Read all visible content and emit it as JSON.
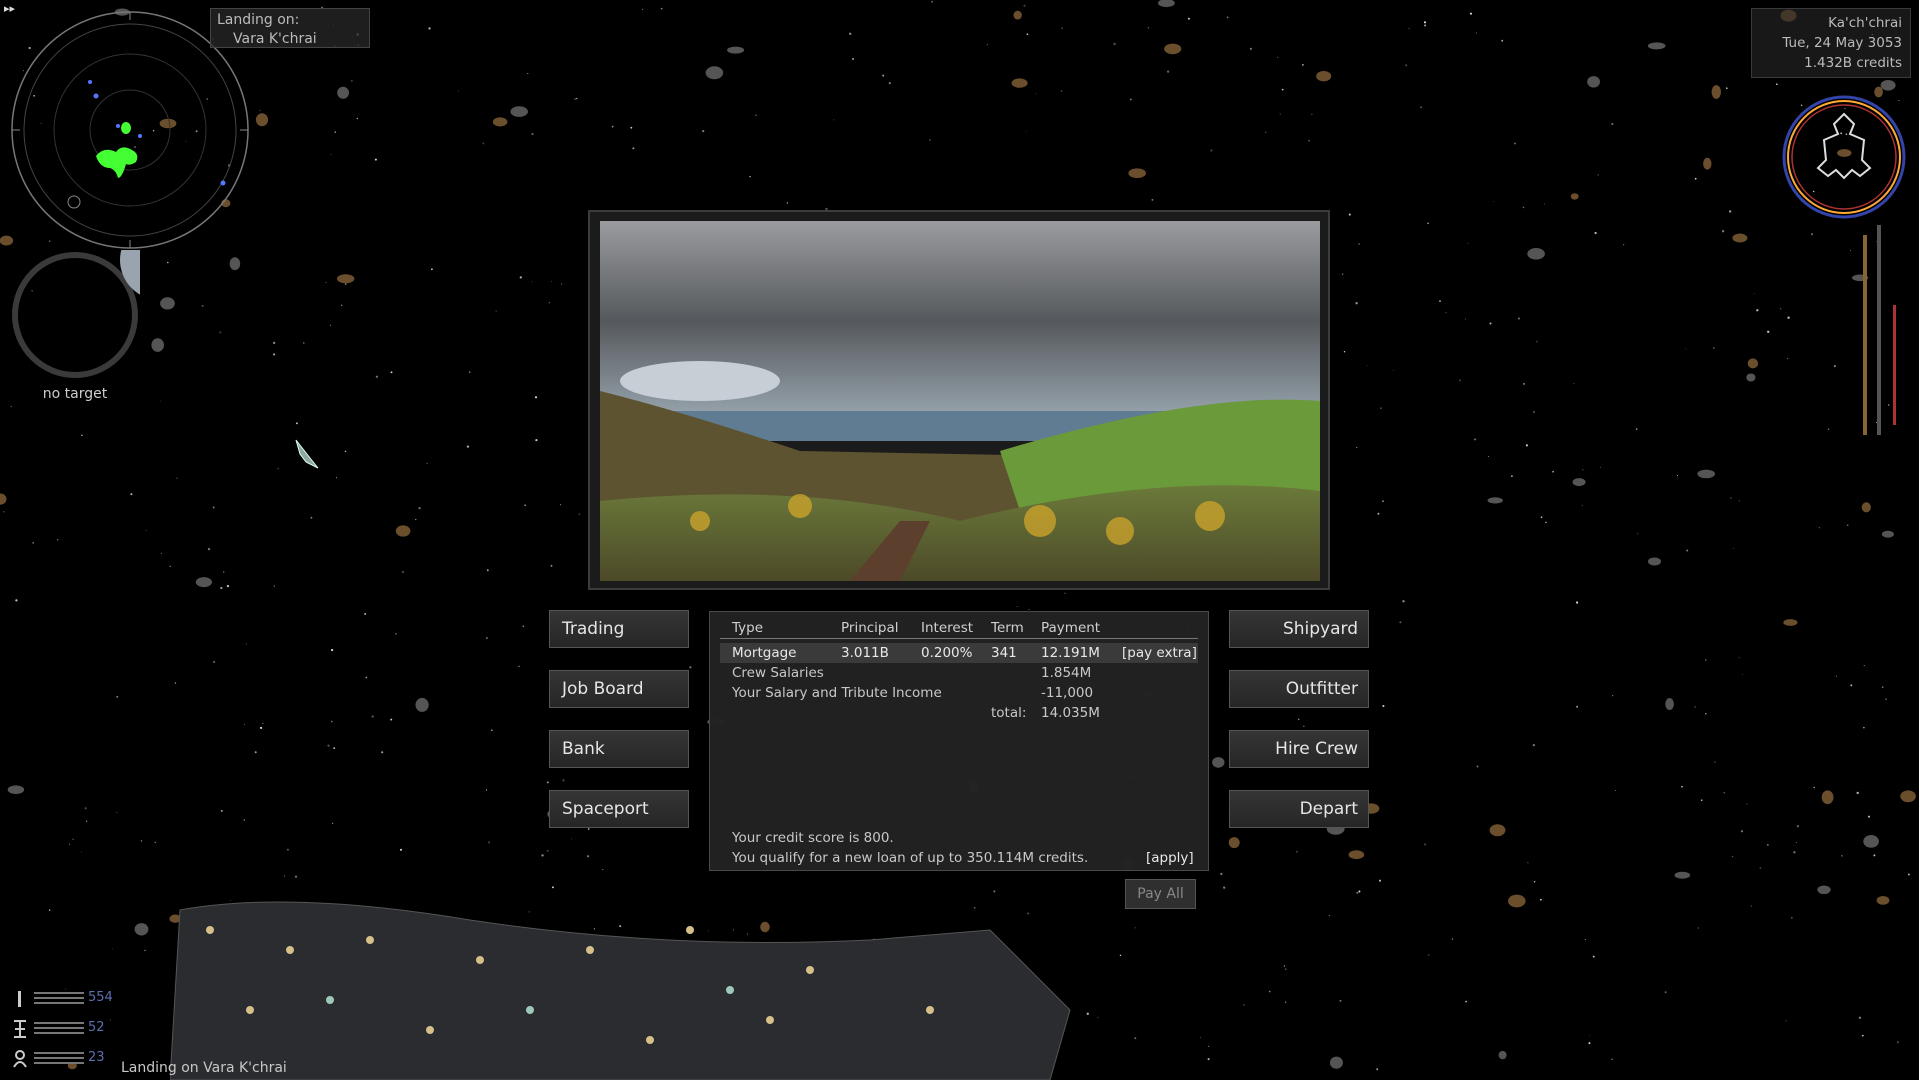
{
  "hud": {
    "corner_glyph": "▸▸",
    "landing_label": "Landing on:",
    "landing_planet": "Vara K'chrai",
    "no_target": "no target",
    "status": {
      "planet": "Ka'ch'chrai",
      "date": "Tue, 24 May 3053",
      "credits": "1.432B credits"
    },
    "stats": [
      {
        "icon": "fuel-icon",
        "value": "554"
      },
      {
        "icon": "crew-icon",
        "value": "52"
      },
      {
        "icon": "bunks-icon",
        "value": "23"
      }
    ],
    "message": "Landing on Vara K'chrai"
  },
  "buttons": {
    "left": [
      "Trading",
      "Job Board",
      "Bank",
      "Spaceport"
    ],
    "right": [
      "Shipyard",
      "Outfitter",
      "Hire Crew",
      "Depart"
    ]
  },
  "bank": {
    "headers": {
      "type": "Type",
      "principal": "Principal",
      "interest": "Interest",
      "term": "Term",
      "payment": "Payment"
    },
    "mortgage": {
      "type": "Mortgage",
      "principal": "3.011B",
      "interest": "0.200%",
      "term": "341",
      "payment": "12.191M",
      "action": "[pay extra]"
    },
    "crew_salaries": {
      "label": "Crew Salaries",
      "payment": "1.854M"
    },
    "income": {
      "label": "Your Salary and Tribute Income",
      "payment": "-11,000"
    },
    "total": {
      "label": "total:",
      "payment": "14.035M"
    },
    "credit_score": "Your credit score is 800.",
    "qualify": "You qualify for a new loan of up to 350.114M credits.",
    "apply": "[apply]",
    "pay_all": "Pay All"
  },
  "colors": {
    "background": "#000000",
    "panel": "#222222",
    "radar_blip_green": "#44ff33",
    "radar_blip_blue": "#5577ff",
    "stat_number": "#5a6fb0"
  }
}
